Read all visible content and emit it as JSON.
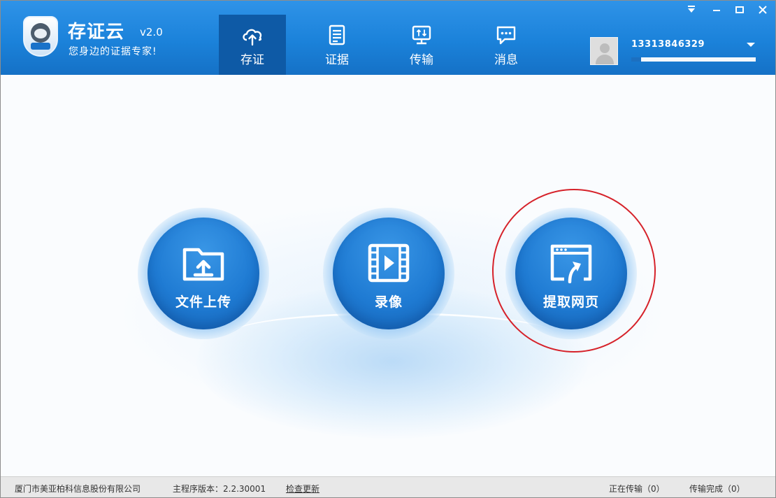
{
  "app": {
    "title": "存证云",
    "version": "v2.0",
    "slogan": "您身边的证据专家!",
    "logo_icon": "shield-mascot-logo",
    "accent_color": "#1b82da",
    "nav_active_color": "#0e5aa6"
  },
  "nav": {
    "items": [
      {
        "label": "存证",
        "icon": "cloud-upload-icon",
        "active": true
      },
      {
        "label": "证据",
        "icon": "document-icon",
        "active": false
      },
      {
        "label": "传输",
        "icon": "transfer-icon",
        "active": false
      },
      {
        "label": "消息",
        "icon": "message-icon",
        "active": false
      }
    ]
  },
  "user": {
    "phone": "13313846329",
    "avatar_icon": "user-avatar-icon",
    "dropdown_icon": "chevron-down-icon",
    "storage_used_fraction": 0.08
  },
  "window_controls": [
    "dropdown-arrow-icon",
    "minimize-icon",
    "maximize-icon",
    "close-icon"
  ],
  "actions": [
    {
      "label": "文件上传",
      "icon": "folder-upload-icon"
    },
    {
      "label": "录像",
      "icon": "film-play-icon"
    },
    {
      "label": "提取网页",
      "icon": "webpage-extract-icon",
      "highlighted": true
    }
  ],
  "highlight_color": "#d6222a",
  "footer": {
    "company": "厦门市美亚柏科信息股份有限公司",
    "version_text": "主程序版本：2.2.30001",
    "update_link": "检查更新",
    "transferring": "正在传输（0）",
    "completed": "传输完成（0）"
  }
}
